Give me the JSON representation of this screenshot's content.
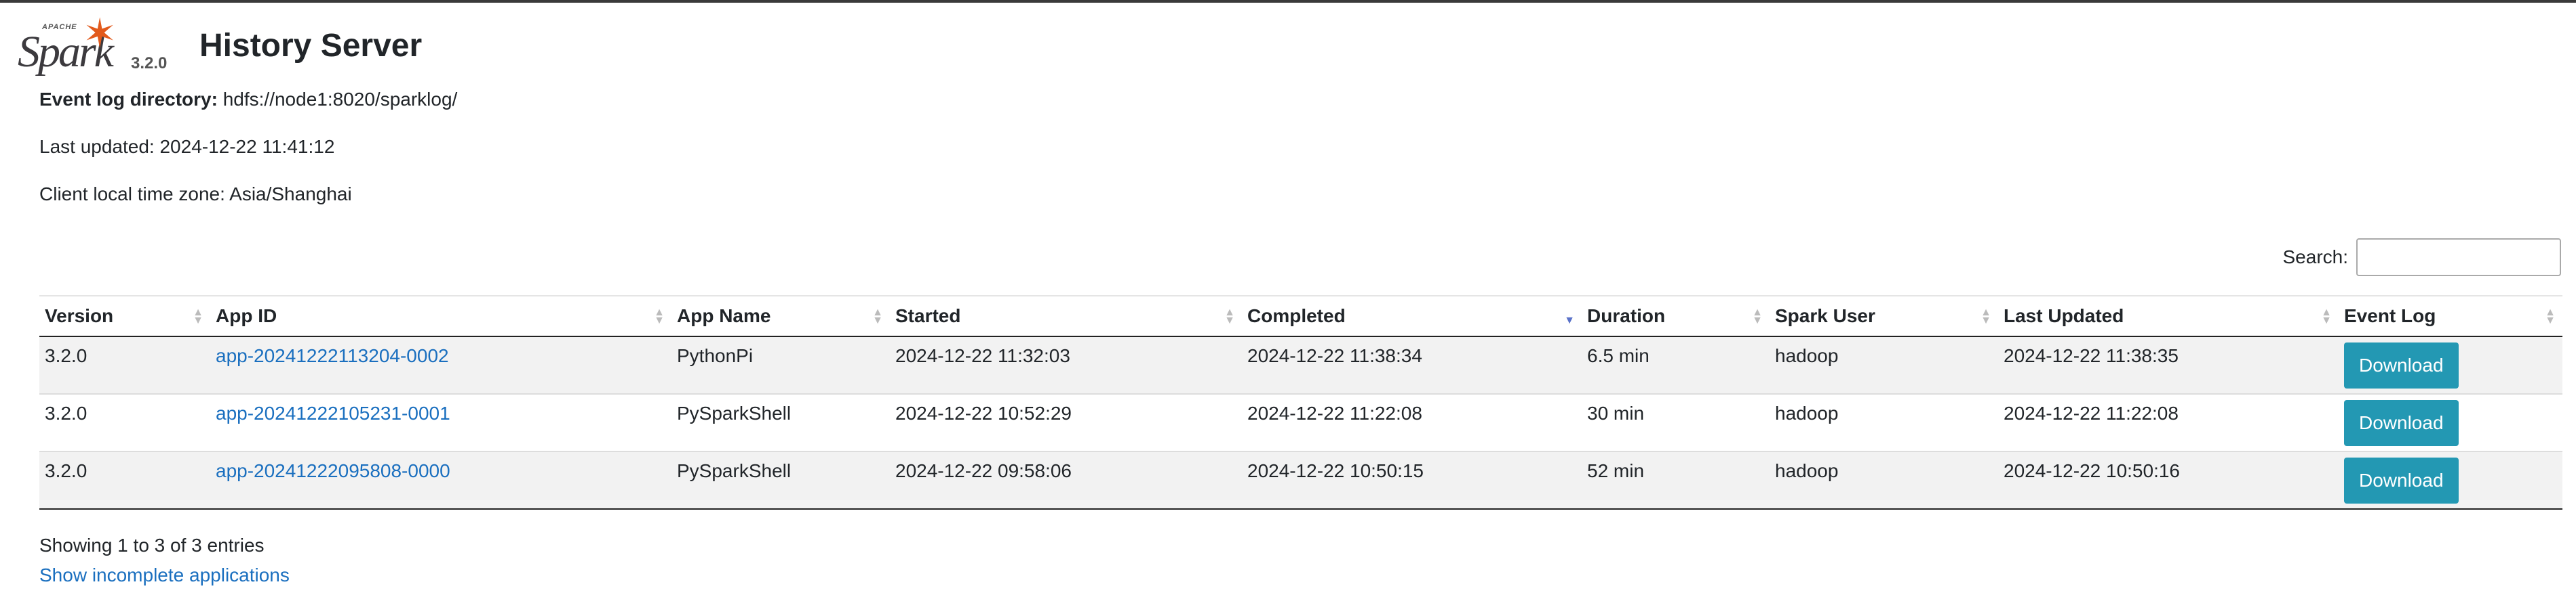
{
  "header": {
    "logo_apache": "APACHE",
    "logo_word": "Spark",
    "version": "3.2.0",
    "title": "History Server"
  },
  "info": {
    "event_log_label": "Event log directory:",
    "event_log_value": "hdfs://node1:8020/sparklog/",
    "last_updated": "Last updated: 2024-12-22 11:41:12",
    "timezone": "Client local time zone: Asia/Shanghai"
  },
  "search": {
    "label": "Search:",
    "value": ""
  },
  "table": {
    "headers": [
      "Version",
      "App ID",
      "App Name",
      "Started",
      "Completed",
      "Duration",
      "Spark User",
      "Last Updated",
      "Event Log"
    ],
    "rows": [
      {
        "version": "3.2.0",
        "app_id": "app-20241222113204-0002",
        "app_name": "PythonPi",
        "started": "2024-12-22 11:32:03",
        "completed": "2024-12-22 11:38:34",
        "duration": "6.5 min",
        "user": "hadoop",
        "last_updated": "2024-12-22 11:38:35",
        "event_log": "Download"
      },
      {
        "version": "3.2.0",
        "app_id": "app-20241222105231-0001",
        "app_name": "PySparkShell",
        "started": "2024-12-22 10:52:29",
        "completed": "2024-12-22 11:22:08",
        "duration": "30 min",
        "user": "hadoop",
        "last_updated": "2024-12-22 11:22:08",
        "event_log": "Download"
      },
      {
        "version": "3.2.0",
        "app_id": "app-20241222095808-0000",
        "app_name": "PySparkShell",
        "started": "2024-12-22 09:58:06",
        "completed": "2024-12-22 10:50:15",
        "duration": "52 min",
        "user": "hadoop",
        "last_updated": "2024-12-22 10:50:16",
        "event_log": "Download"
      }
    ]
  },
  "footer": {
    "showing": "Showing 1 to 3 of 3 entries",
    "incomplete_link": "Show incomplete applications"
  },
  "colors": {
    "accent": "#2398b3",
    "link": "#1a6fbf",
    "logo_star": "#e25a1c"
  }
}
